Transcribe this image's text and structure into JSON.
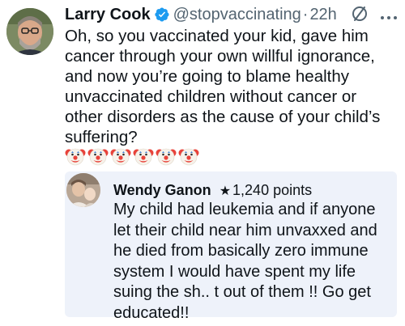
{
  "tweet": {
    "author_name": "Larry Cook",
    "handle": "@stopvaccinating",
    "separator": "·",
    "time": "22h",
    "verified_color": "#1d9bf0",
    "body": "Oh, so you vaccinated your kid, gave him cancer through your own willful ignorance, and now you’re going to blame healthy unvaccinated children without cancer or other disorders as the cause of your child’s suffering?",
    "emoji_count": 6,
    "emoji": "clown-face"
  },
  "quoted_comment": {
    "author_name": "Wendy Ganon",
    "star": "★",
    "points": "1,240 points",
    "text": "My child had leukemia and if anyone let their child near him unvaxxed and he died from basically zero immune system I would have spent my life suing the sh.. t out of them !! Go get educated!!"
  },
  "icons": {
    "avatar": "profile-photo",
    "verified": "verified-badge-icon",
    "grok": "slash-circle-icon",
    "more": "more-dots-icon"
  }
}
